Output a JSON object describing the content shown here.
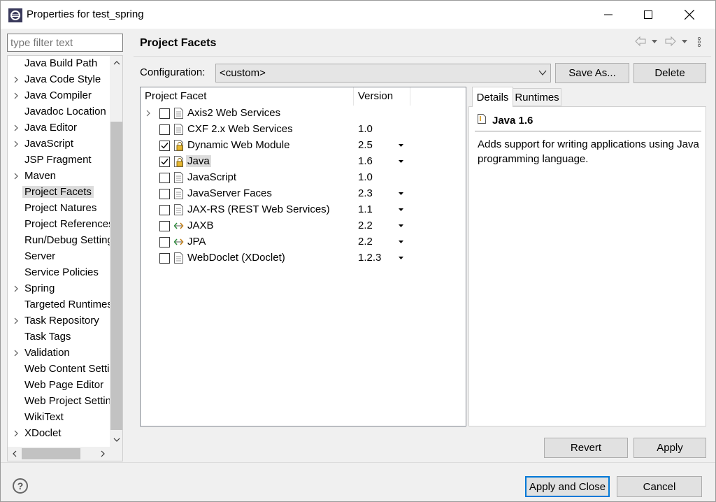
{
  "window": {
    "title": "Properties for test_spring"
  },
  "filter": {
    "placeholder": "type filter text"
  },
  "tree": {
    "items": [
      {
        "label": "Java Build Path",
        "expandable": false
      },
      {
        "label": "Java Code Style",
        "expandable": true
      },
      {
        "label": "Java Compiler",
        "expandable": true
      },
      {
        "label": "Javadoc Location",
        "expandable": false
      },
      {
        "label": "Java Editor",
        "expandable": true
      },
      {
        "label": "JavaScript",
        "expandable": true
      },
      {
        "label": "JSP Fragment",
        "expandable": false
      },
      {
        "label": "Maven",
        "expandable": true
      },
      {
        "label": "Project Facets",
        "expandable": false,
        "selected": true
      },
      {
        "label": "Project Natures",
        "expandable": false
      },
      {
        "label": "Project References",
        "expandable": false
      },
      {
        "label": "Run/Debug Settings",
        "expandable": false
      },
      {
        "label": "Server",
        "expandable": false
      },
      {
        "label": "Service Policies",
        "expandable": false
      },
      {
        "label": "Spring",
        "expandable": true
      },
      {
        "label": "Targeted Runtimes",
        "expandable": false
      },
      {
        "label": "Task Repository",
        "expandable": true
      },
      {
        "label": "Task Tags",
        "expandable": false
      },
      {
        "label": "Validation",
        "expandable": true
      },
      {
        "label": "Web Content Settings",
        "expandable": false
      },
      {
        "label": "Web Page Editor",
        "expandable": false
      },
      {
        "label": "Web Project Settings",
        "expandable": false
      },
      {
        "label": "WikiText",
        "expandable": false
      },
      {
        "label": "XDoclet",
        "expandable": true
      }
    ]
  },
  "page": {
    "title": "Project Facets"
  },
  "configuration": {
    "label": "Configuration:",
    "value": "<custom>",
    "save_as_label": "Save As...",
    "delete_label": "Delete"
  },
  "facets": {
    "col_facet": "Project Facet",
    "col_version": "Version",
    "rows": [
      {
        "name": "Axis2 Web Services",
        "version": "",
        "checked": false,
        "expandable": true,
        "icon": "doc",
        "dropdown": false
      },
      {
        "name": "CXF 2.x Web Services",
        "version": "1.0",
        "checked": false,
        "icon": "doc",
        "dropdown": false
      },
      {
        "name": "Dynamic Web Module",
        "version": "2.5",
        "checked": true,
        "icon": "locked-doc",
        "dropdown": true
      },
      {
        "name": "Java",
        "version": "1.6",
        "checked": true,
        "icon": "locked-doc",
        "dropdown": true,
        "selected": true
      },
      {
        "name": "JavaScript",
        "version": "1.0",
        "checked": false,
        "icon": "doc",
        "dropdown": false
      },
      {
        "name": "JavaServer Faces",
        "version": "2.3",
        "checked": false,
        "icon": "doc",
        "dropdown": true
      },
      {
        "name": "JAX-RS (REST Web Services)",
        "version": "1.1",
        "checked": false,
        "icon": "doc",
        "dropdown": true
      },
      {
        "name": "JAXB",
        "version": "2.2",
        "checked": false,
        "icon": "arrows",
        "dropdown": true
      },
      {
        "name": "JPA",
        "version": "2.2",
        "checked": false,
        "icon": "arrows",
        "dropdown": true
      },
      {
        "name": "WebDoclet (XDoclet)",
        "version": "1.2.3",
        "checked": false,
        "icon": "doc",
        "dropdown": true
      }
    ]
  },
  "details": {
    "tab_details": "Details",
    "tab_runtimes": "Runtimes",
    "title": "Java 1.6",
    "description": "Adds support for writing applications using Java programming language."
  },
  "buttons": {
    "revert": "Revert",
    "apply": "Apply",
    "apply_and_close": "Apply and Close",
    "cancel": "Cancel",
    "help": "?"
  },
  "colors": {
    "accent": "#0078d7",
    "selection": "#dcdcdc"
  }
}
